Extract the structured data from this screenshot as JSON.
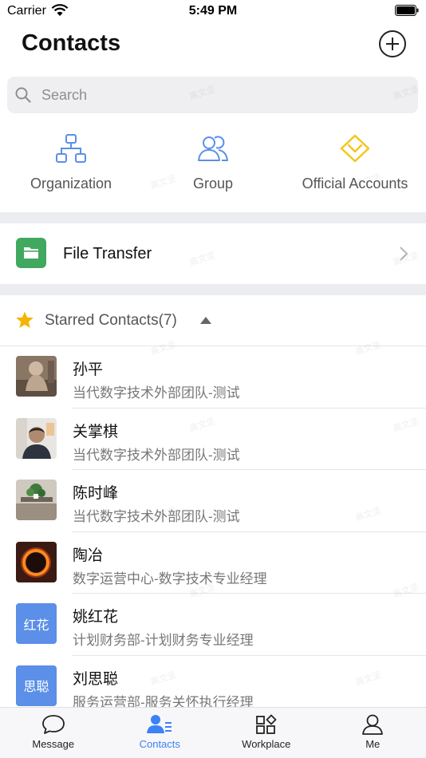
{
  "status_bar": {
    "carrier": "Carrier",
    "time": "5:49 PM"
  },
  "header": {
    "title": "Contacts"
  },
  "search": {
    "placeholder": "Search"
  },
  "quick_actions": [
    {
      "label": "Organization",
      "icon": "org-chart-icon",
      "color": "#5b8fe8"
    },
    {
      "label": "Group",
      "icon": "group-icon",
      "color": "#5b8fe8"
    },
    {
      "label": "Official Accounts",
      "icon": "official-accounts-icon",
      "color": "#f5c518"
    }
  ],
  "file_transfer": {
    "label": "File Transfer",
    "icon": "folder-icon",
    "color": "#41a85f"
  },
  "starred": {
    "label": "Starred Contacts(7)"
  },
  "contacts": [
    {
      "name": "孙平",
      "dept": "当代数字技术外部团队-测试",
      "avatar": "photo-statue"
    },
    {
      "name": "关掌棋",
      "dept": "当代数字技术外部团队-测试",
      "avatar": "photo-man"
    },
    {
      "name": "陈时峰",
      "dept": "当代数字技术外部团队-测试",
      "avatar": "photo-plant"
    },
    {
      "name": "陶冶",
      "dept": "数字运营中心-数字技术专业经理",
      "avatar": "photo-eclipse"
    },
    {
      "name": "姚红花",
      "dept": "计划财务部-计划财务专业经理",
      "avatar_text": "红花"
    },
    {
      "name": "刘思聪",
      "dept": "服务运营部-服务关怀执行经理",
      "avatar_text": "思聪"
    }
  ],
  "tabs": [
    {
      "label": "Message",
      "icon": "chat-bubble-icon"
    },
    {
      "label": "Contacts",
      "icon": "contacts-icon"
    },
    {
      "label": "Workplace",
      "icon": "workplace-icon"
    },
    {
      "label": "Me",
      "icon": "person-icon"
    }
  ],
  "watermark": "高文坚",
  "colors": {
    "accent": "#3b82f6",
    "avatar_blue": "#5b8fe8",
    "divider": "#ebedf0"
  }
}
